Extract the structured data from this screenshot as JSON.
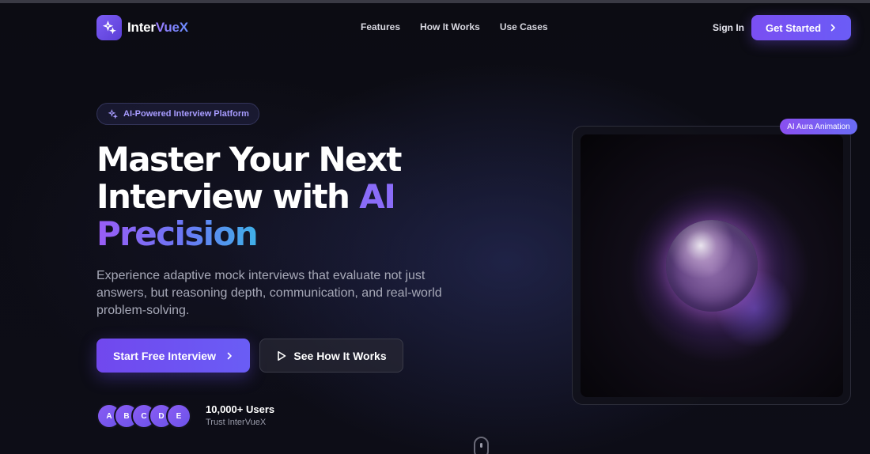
{
  "brand": {
    "name_part1": "Inter",
    "name_part2": "VueX"
  },
  "nav": {
    "links": [
      "Features",
      "How It Works",
      "Use Cases"
    ],
    "sign_in": "Sign In",
    "get_started": "Get Started"
  },
  "hero": {
    "badge": "AI-Powered Interview Platform",
    "headline_line1": "Master Your Next",
    "headline_line2_prefix": "Interview with ",
    "headline_line2_accent": "AI",
    "headline_line3": "Precision",
    "subtext": "Experience adaptive mock interviews that evaluate not just answers, but reasoning depth, communication, and real-world problem-solving.",
    "primary_cta": "Start Free Interview",
    "secondary_cta": "See How It Works"
  },
  "social_proof": {
    "avatars": [
      "A",
      "B",
      "C",
      "D",
      "E"
    ],
    "count": "10,000+ Users",
    "caption": "Trust InterVueX"
  },
  "aura": {
    "badge": "AI Aura Animation"
  },
  "icons": {
    "logo": "sparkles-icon",
    "badge": "sparkles-icon",
    "chevron": "chevron-right-icon",
    "play": "play-icon"
  },
  "colors": {
    "accent": "#7c5cf4",
    "accent_blue": "#3fb0e8",
    "background": "#0b0b12"
  }
}
